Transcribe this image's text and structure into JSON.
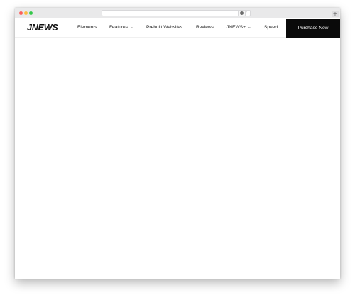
{
  "browser": {
    "reload_icon": "reload-icon",
    "extension_icon": "extension-icon",
    "newtab_symbol": "+"
  },
  "header": {
    "logo": "JNEWS",
    "nav": [
      {
        "label": "Elements"
      },
      {
        "label": "Features",
        "has_dropdown": true
      },
      {
        "label": "Prebuilt Websites"
      },
      {
        "label": "Reviews"
      },
      {
        "label": "JNEWS+",
        "has_dropdown": true
      },
      {
        "label": "Speed"
      }
    ],
    "cta_label": "Purchase Now"
  },
  "colors": {
    "cta_background": "#0a0a0a",
    "cta_text": "#ffffff",
    "traffic_red": "#fc605c",
    "traffic_yellow": "#fdbc40",
    "traffic_green": "#34c84a"
  }
}
